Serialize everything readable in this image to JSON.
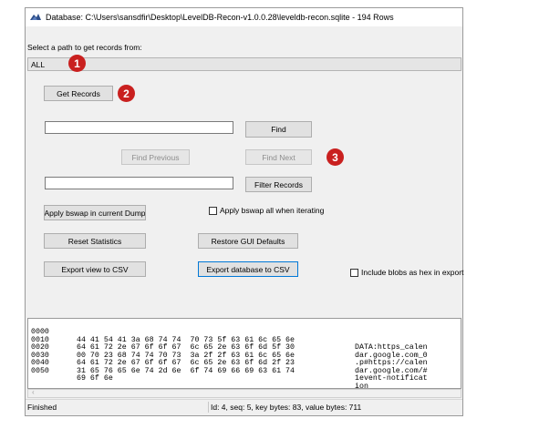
{
  "window": {
    "title": "Database: C:\\Users\\sansdfir\\Desktop\\LevelDB-Recon-v1.0.0.28\\leveldb-recon.sqlite  -  194 Rows"
  },
  "path_selector": {
    "label": "Select a path to get records from:",
    "value": "ALL"
  },
  "buttons": {
    "get_records": "Get Records",
    "find": "Find",
    "find_previous": "Find Previous",
    "find_next": "Find Next",
    "filter_records": "Filter Records",
    "apply_bswap_dump": "Apply bswap in current Dump",
    "reset_statistics": "Reset Statistics",
    "restore_gui_defaults": "Restore GUI Defaults",
    "export_view_csv": "Export view to CSV",
    "export_database_csv": "Export database to CSV"
  },
  "inputs": {
    "find_value": "",
    "filter_value": ""
  },
  "checkboxes": {
    "apply_bswap_all": "Apply bswap all when iterating",
    "include_blobs_hex": "Include blobs as hex in export"
  },
  "markers": [
    "1",
    "2",
    "3"
  ],
  "hex_rows": [
    {
      "offset": "0000",
      "bytes": "44 41 54 41 3a 68 74 74  70 73 5f 63 61 6c 65 6e",
      "ascii": "DATA:https_calen"
    },
    {
      "offset": "0010",
      "bytes": "64 61 72 2e 67 6f 6f 67  6c 65 2e 63 6f 6d 5f 30",
      "ascii": "dar.google.com_0"
    },
    {
      "offset": "0020",
      "bytes": "00 70 23 68 74 74 70 73  3a 2f 2f 63 61 6c 65 6e",
      "ascii": ".p#https://calen"
    },
    {
      "offset": "0030",
      "bytes": "64 61 72 2e 67 6f 6f 67  6c 65 2e 63 6f 6d 2f 23",
      "ascii": "dar.google.com/#"
    },
    {
      "offset": "0040",
      "bytes": "31 65 76 65 6e 74 2d 6e  6f 74 69 66 69 63 61 74",
      "ascii": "1event-notificat"
    },
    {
      "offset": "0050",
      "bytes": "69 6f 6e",
      "ascii": "ion"
    }
  ],
  "statusbar": {
    "left": "Finished",
    "right": "Id: 4, seq: 5, key bytes: 83, value bytes: 711"
  },
  "colors": {
    "marker": "#c9201f",
    "focus_border": "#0078d7"
  }
}
